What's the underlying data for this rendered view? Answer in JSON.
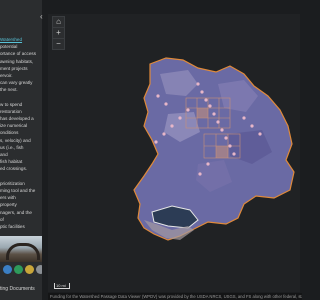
{
  "panel": {
    "collapse_icon": "chevron-left-icon",
    "lines": [
      {
        "text": "Watershed",
        "link": true
      },
      {
        "text": "potential",
        "link": false
      },
      {
        "text": "ortance of access",
        "link": false
      },
      {
        "text": "awning habitats,",
        "link": false
      },
      {
        "text": "ment projects",
        "link": false
      },
      {
        "text": "ervoir.",
        "link": false
      },
      {
        "text": "can vary greatly",
        "link": false
      },
      {
        "text": "the next.",
        "link": false
      },
      {
        "text": "",
        "link": false
      },
      {
        "text": "w to spend",
        "link": false
      },
      {
        "text": "restoration",
        "link": false
      },
      {
        "text": "has developed a",
        "link": false
      },
      {
        "text": "ize numerical",
        "link": false
      },
      {
        "text": "onditions",
        "link": false
      },
      {
        "text": "s, velocity) and",
        "link": false
      },
      {
        "text": "us (i.e., fish",
        "link": false
      },
      {
        "text": "and",
        "link": false
      },
      {
        "text": "fish habitat",
        "link": false
      },
      {
        "text": "ed crossings.",
        "link": false
      },
      {
        "text": "",
        "link": false
      },
      {
        "text": "prioritization",
        "link": false
      },
      {
        "text": "ming tool and the",
        "link": false
      },
      {
        "text": "ers with",
        "link": false
      },
      {
        "text": "property",
        "link": false
      },
      {
        "text": "nagers, and the",
        "link": false
      },
      {
        "text": "of",
        "link": false
      },
      {
        "text": "ptic facilities",
        "link": false
      }
    ],
    "footer": "ting Documents"
  },
  "map": {
    "controls": {
      "home_icon": "home-icon",
      "zoom_in": "+",
      "zoom_out": "−"
    },
    "scale_label": "10 mi",
    "attribution": "Funding for the Watershed Passage Data Viewer (WPDV) was provided by the USDA NRCS, USGS, and FS along with other federal, state and local ag"
  },
  "colors": {
    "watershed_fill": "#6a6aa4",
    "watershed_outline": "#e08a3a",
    "grid_highlight": "#c98f78",
    "stream_points": "#e7b6c8",
    "lake": "#2c3c55",
    "link": "#58c2d7"
  }
}
